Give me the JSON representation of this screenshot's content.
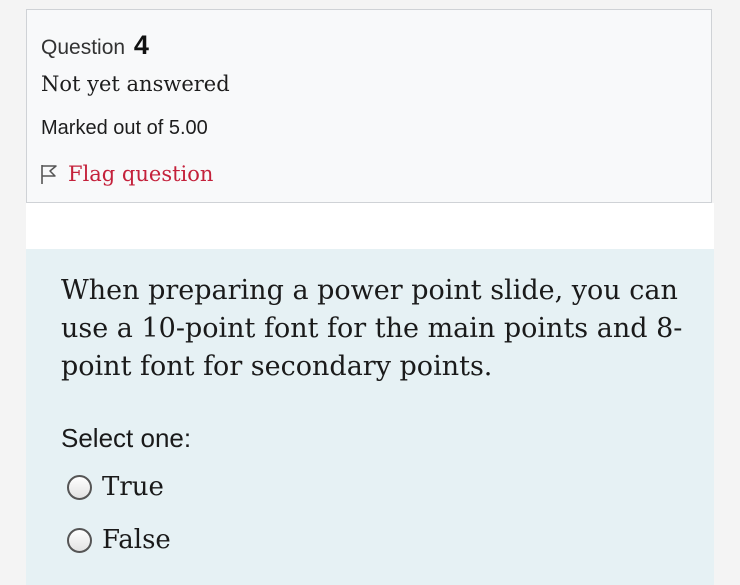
{
  "question": {
    "label": "Question",
    "number": "4",
    "state": "Not yet answered",
    "grade": "Marked out of 5.00",
    "flag_label": "Flag question",
    "text": "When preparing a power point slide, you can use a 10-point font for the main points and 8-point font for secondary points.",
    "prompt": "Select one:",
    "options": [
      {
        "label": "True",
        "selected": false
      },
      {
        "label": "False",
        "selected": false
      }
    ]
  },
  "colors": {
    "flag": "#c4213b",
    "content_background": "#e6f1f4",
    "info_background": "#f8f9fa"
  },
  "icons": {
    "flag": "flag-outline-icon",
    "radio": "radio-unchecked-icon"
  }
}
